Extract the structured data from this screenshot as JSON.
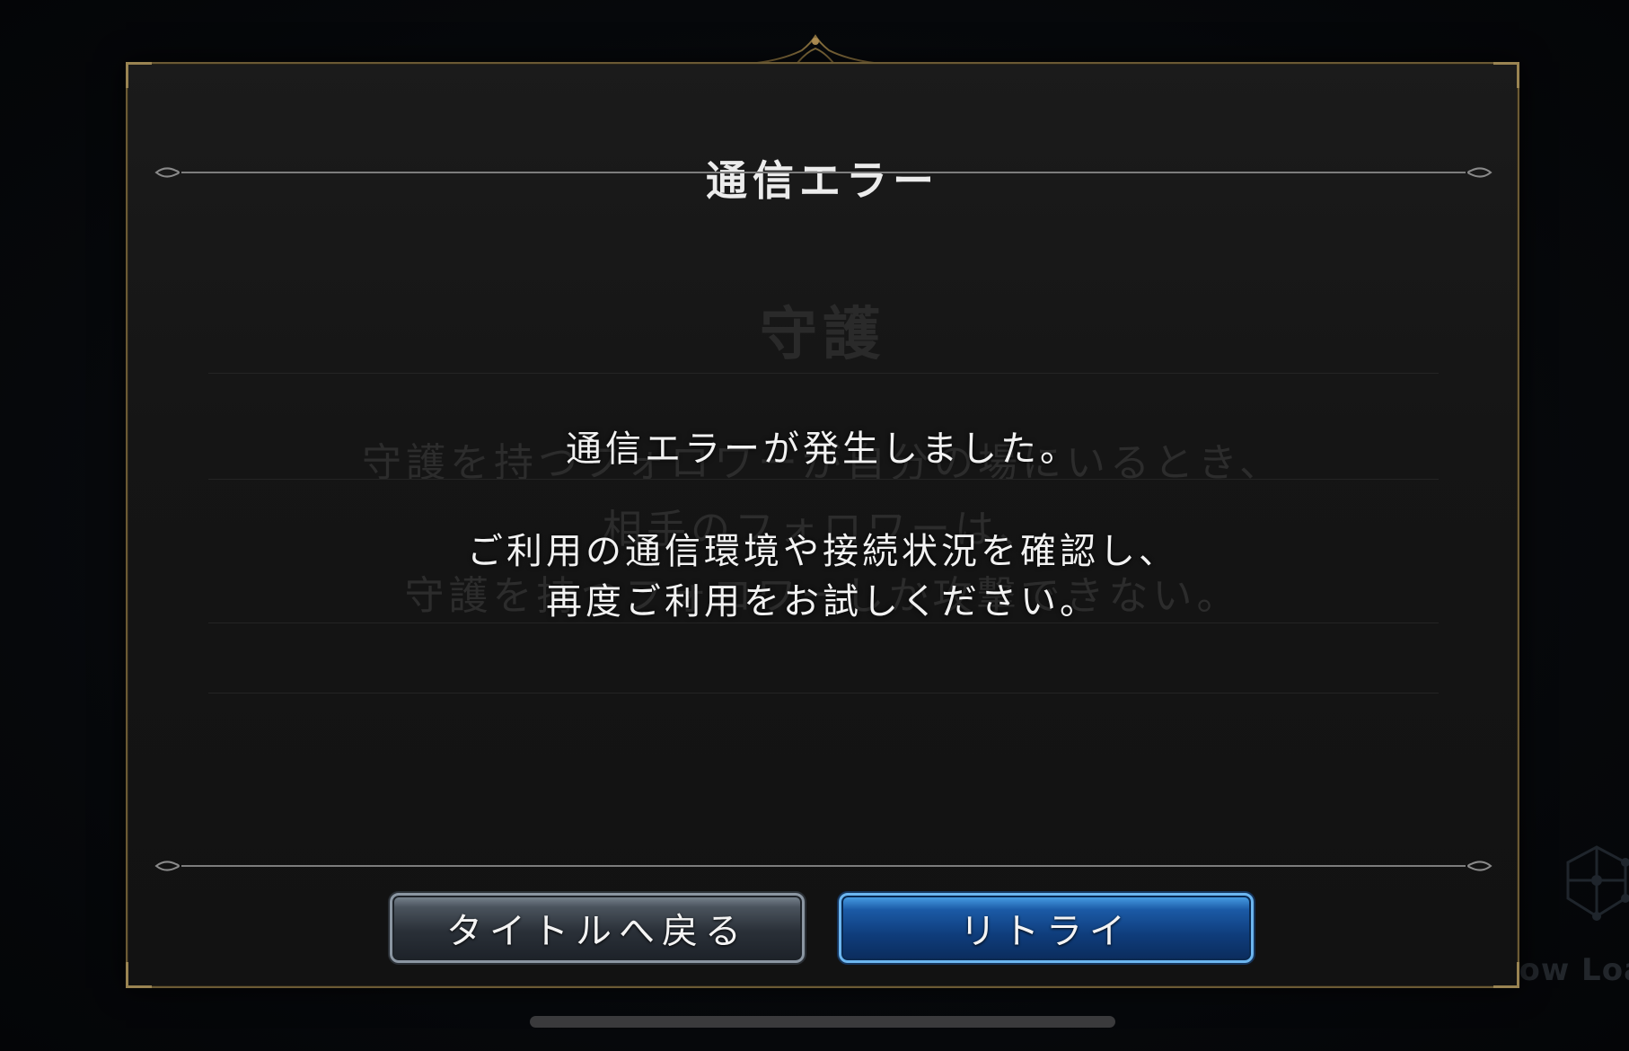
{
  "dialog": {
    "title": "通信エラー",
    "message_line1": "通信エラーが発生しました。",
    "message_line2": "ご利用の通信環境や接続状況を確認し、",
    "message_line3": "再度ご利用をお試しください。"
  },
  "buttons": {
    "back_to_title": "タイトルへ戻る",
    "retry": "リトライ"
  },
  "background": {
    "card_title": "守護",
    "card_line1": "守護を持つフォロワーが自分の場にいるとき、",
    "card_line2": "相手のフォロワーは、",
    "card_line3": "守護を持つフォロワーしか攻撃できない。",
    "loading_text": "Now Loading"
  },
  "colors": {
    "frame_gold": "#6b5a34",
    "retry_blue": "#1b5aa6",
    "title_button_steel": "#4a535d"
  }
}
